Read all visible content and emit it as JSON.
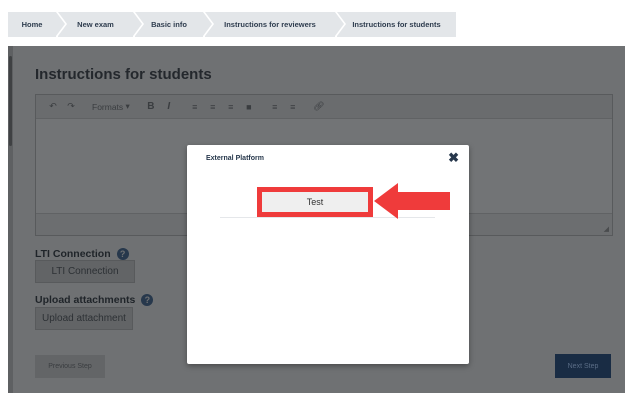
{
  "breadcrumb": {
    "items": [
      "Home",
      "New exam",
      "Basic info",
      "Instructions for reviewers",
      "Instructions for students"
    ]
  },
  "page": {
    "title": "Instructions for students"
  },
  "editor": {
    "formats_label": "Formats",
    "tools": [
      "undo-icon",
      "redo-icon",
      "bold-icon",
      "italic-icon",
      "align-left-icon",
      "align-center-icon",
      "align-right-icon",
      "align-justify-icon",
      "indent-icon",
      "outdent-icon",
      "link-icon"
    ]
  },
  "lti": {
    "label": "LTI Connection",
    "button": "LTI Connection"
  },
  "upload": {
    "label": "Upload attachments",
    "button": "Upload attachment"
  },
  "footer": {
    "previous": "Previous Step",
    "next": "Next Step"
  },
  "modal": {
    "title": "External Platform",
    "test_button": "Test",
    "highlight_color": "#ef3b3b"
  },
  "colors": {
    "overlay": "#6f7173",
    "primary": "#192c44",
    "breadcrumb_bg": "#e3e6e9"
  }
}
